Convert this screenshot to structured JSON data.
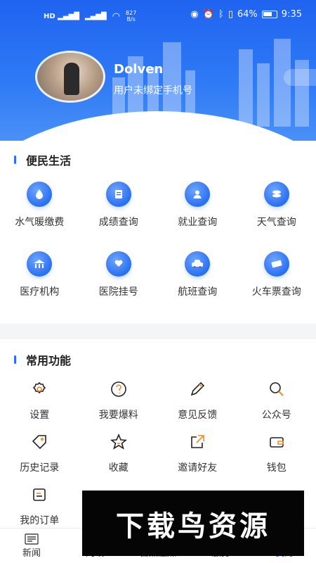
{
  "status_bar": {
    "net_speed": "827",
    "net_unit": "B/s",
    "battery": "64%",
    "time": "9:35"
  },
  "profile": {
    "username": "Dolven",
    "phone_hint": "用户未绑定手机号"
  },
  "services": {
    "title": "便民生活",
    "items": [
      {
        "label": "水气暖缴费",
        "icon": "water-drop-icon"
      },
      {
        "label": "成绩查询",
        "icon": "document-icon"
      },
      {
        "label": "就业查询",
        "icon": "person-card-icon"
      },
      {
        "label": "天气查询",
        "icon": "cloud-icon"
      },
      {
        "label": "医疗机构",
        "icon": "hospital-icon"
      },
      {
        "label": "医院挂号",
        "icon": "heart-hand-icon"
      },
      {
        "label": "航班查询",
        "icon": "car-icon"
      },
      {
        "label": "火车票查询",
        "icon": "ticket-icon"
      }
    ]
  },
  "functions": {
    "title": "常用功能",
    "items": [
      {
        "label": "设置",
        "icon": "gear-icon"
      },
      {
        "label": "我要爆料",
        "icon": "question-icon"
      },
      {
        "label": "意见反馈",
        "icon": "pencil-icon"
      },
      {
        "label": "公众号",
        "icon": "search-icon"
      },
      {
        "label": "历史记录",
        "icon": "tag-icon"
      },
      {
        "label": "收藏",
        "icon": "star-icon"
      },
      {
        "label": "邀请好友",
        "icon": "share-icon"
      },
      {
        "label": "钱包",
        "icon": "wallet-icon"
      },
      {
        "label": "我的订单",
        "icon": "order-icon"
      }
    ]
  },
  "tabbar": {
    "items": [
      {
        "label": "新闻",
        "active": false
      },
      {
        "label": "问政",
        "active": false
      },
      {
        "label": "自然融媒",
        "active": false
      },
      {
        "label": "服务",
        "active": false
      },
      {
        "label": "我的",
        "active": true
      }
    ]
  },
  "watermark": "下载鸟资源",
  "colors": {
    "accent": "#2b6ef5",
    "header": "#1f63f0"
  }
}
